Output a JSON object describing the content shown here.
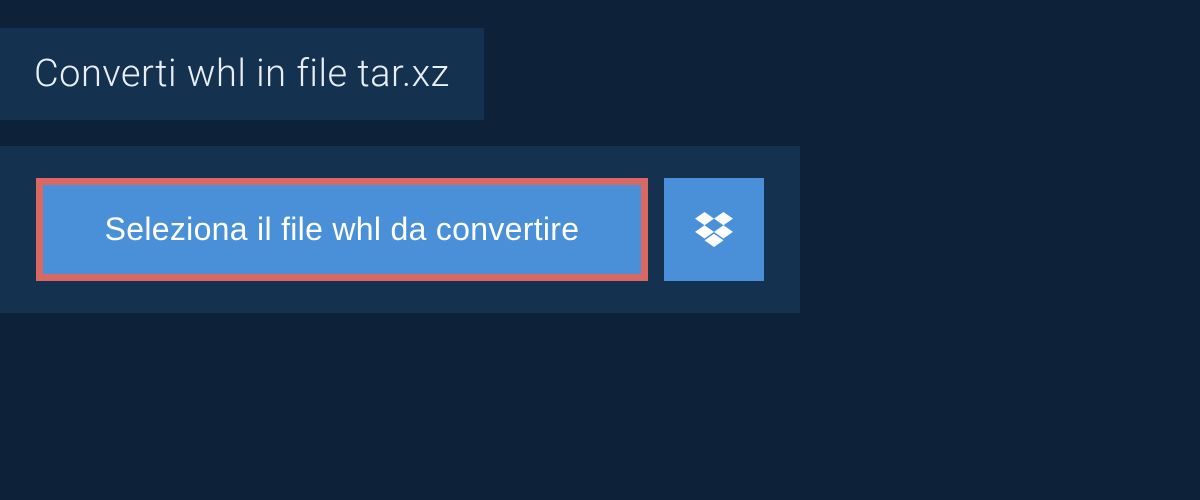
{
  "header": {
    "title": "Converti whl in file tar.xz"
  },
  "upload": {
    "select_file_label": "Seleziona il file whl da convertire",
    "dropbox_icon_name": "dropbox"
  },
  "colors": {
    "background": "#0d2139",
    "panel": "#14324f",
    "button_primary": "#4a90d9",
    "button_border_highlight": "#d96862",
    "text_light": "#e8eef4"
  }
}
